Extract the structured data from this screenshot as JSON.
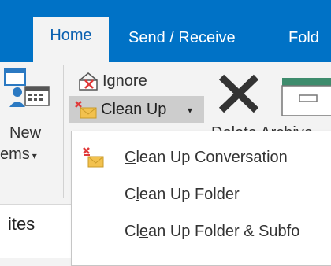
{
  "tabs": {
    "home": "Home",
    "send_receive": "Send / Receive",
    "folder": "Fold"
  },
  "ribbon": {
    "new_items": {
      "line1": "New",
      "line2": "ems",
      "chevron": "▾"
    },
    "ignore": "Ignore",
    "clean_up": {
      "label": "Clean Up",
      "chevron": "▾"
    },
    "delete_archive_clipped": "Delete  Archive"
  },
  "sidebar": {
    "favorites_clipped": "ites"
  },
  "cleanup_menu": {
    "items": [
      {
        "pre": "",
        "u": "C",
        "post": "lean Up Conversation"
      },
      {
        "pre": "C",
        "u": "l",
        "post": "ean Up Folder"
      },
      {
        "pre": "Cl",
        "u": "e",
        "post": "an Up Folder & Subfo"
      }
    ]
  },
  "colors": {
    "accent": "#0072c6",
    "ribbon_bg": "#f3f3f3",
    "pressed_button": "#cdcdcd",
    "cleanup_red": "#e03a3a",
    "envelope_yellow": "#f2c14e"
  },
  "icons": {
    "new_items": "new-items-icon",
    "ignore": "ignore-icon",
    "clean_up": "cleanup-icon",
    "delete": "delete-x-icon",
    "archive": "archive-icon"
  }
}
